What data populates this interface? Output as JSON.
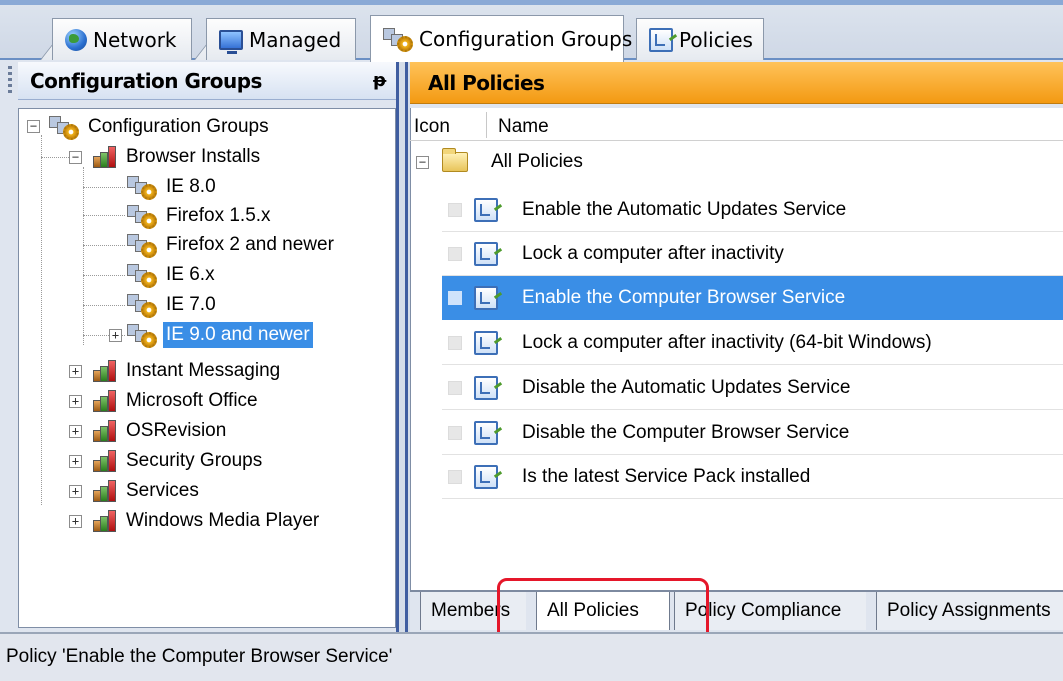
{
  "top_tabs": [
    {
      "label": "Network",
      "icon": "globe-icon"
    },
    {
      "label": "Managed",
      "icon": "monitor-icon"
    },
    {
      "label": "Configuration Groups",
      "icon": "config-groups-icon"
    },
    {
      "label": "Policies",
      "icon": "policy-icon"
    }
  ],
  "left_panel": {
    "title": "Configuration Groups",
    "pin_glyph": "ᵽ",
    "tree": {
      "root": "Configuration Groups",
      "browser_installs": "Browser Installs",
      "browser_children": [
        "IE 8.0",
        "Firefox 1.5.x",
        "Firefox 2 and newer",
        "IE 6.x",
        "IE 7.0",
        "IE 9.0 and newer"
      ],
      "other_groups": [
        "Instant Messaging",
        "Microsoft Office",
        "OSRevision",
        "Security Groups",
        "Services",
        "Windows Media Player"
      ]
    }
  },
  "right_panel": {
    "title": "All Policies",
    "columns": [
      "Icon",
      "Name"
    ],
    "folder_label": "All Policies",
    "policies": [
      "Enable the Automatic Updates Service",
      "Lock a computer after inactivity",
      "Enable the Computer Browser Service",
      "Lock a computer after inactivity (64-bit Windows)",
      "Disable the Automatic Updates Service",
      "Disable the Computer Browser Service",
      "Is the latest Service Pack installed"
    ],
    "selected_policy": "Enable the Computer Browser Service"
  },
  "bottom_tabs": [
    "Members",
    "All Policies",
    "Policy Compliance",
    "Policy Assignments"
  ],
  "active_bottom_tab": "All Policies",
  "status": "Policy 'Enable the Computer Browser Service'",
  "colors": {
    "selection": "#3a8ee6",
    "header_orange": "#f39a12",
    "highlight_box": "#e5172a"
  }
}
